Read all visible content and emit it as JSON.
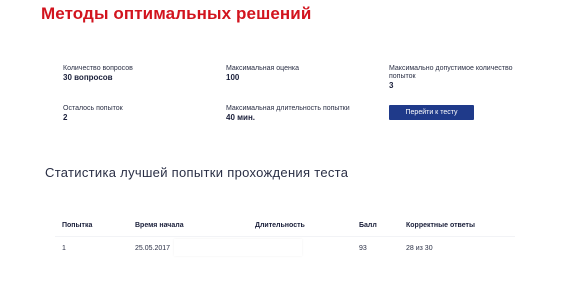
{
  "page": {
    "title": "Методы оптимальных решений"
  },
  "info": {
    "questions_label": "Количество вопросов",
    "questions_value": "30 вопросов",
    "max_score_label": "Максимальная оценка",
    "max_score_value": "100",
    "max_attempts_label": "Максимально допустимое количество попыток",
    "max_attempts_value": "3",
    "attempts_left_label": "Осталось попыток",
    "attempts_left_value": "2",
    "max_duration_label": "Максимальная длительность попытки",
    "max_duration_value": "40 мин."
  },
  "actions": {
    "go_to_test_label": "Перейти к тесту",
    "button_color": "#1f3a8a"
  },
  "stats": {
    "title": "Статистика лучшей попытки прохождения теста",
    "columns": [
      "Попытка",
      "Время начала",
      "Длительность",
      "Балл",
      "Корректные ответы"
    ],
    "rows": [
      {
        "attempt": "1",
        "start": "25.05.2017",
        "duration": "",
        "score": "93",
        "correct": "28 из 30"
      }
    ]
  },
  "colors": {
    "title": "#d2141e",
    "text": "#1a1f3a"
  }
}
